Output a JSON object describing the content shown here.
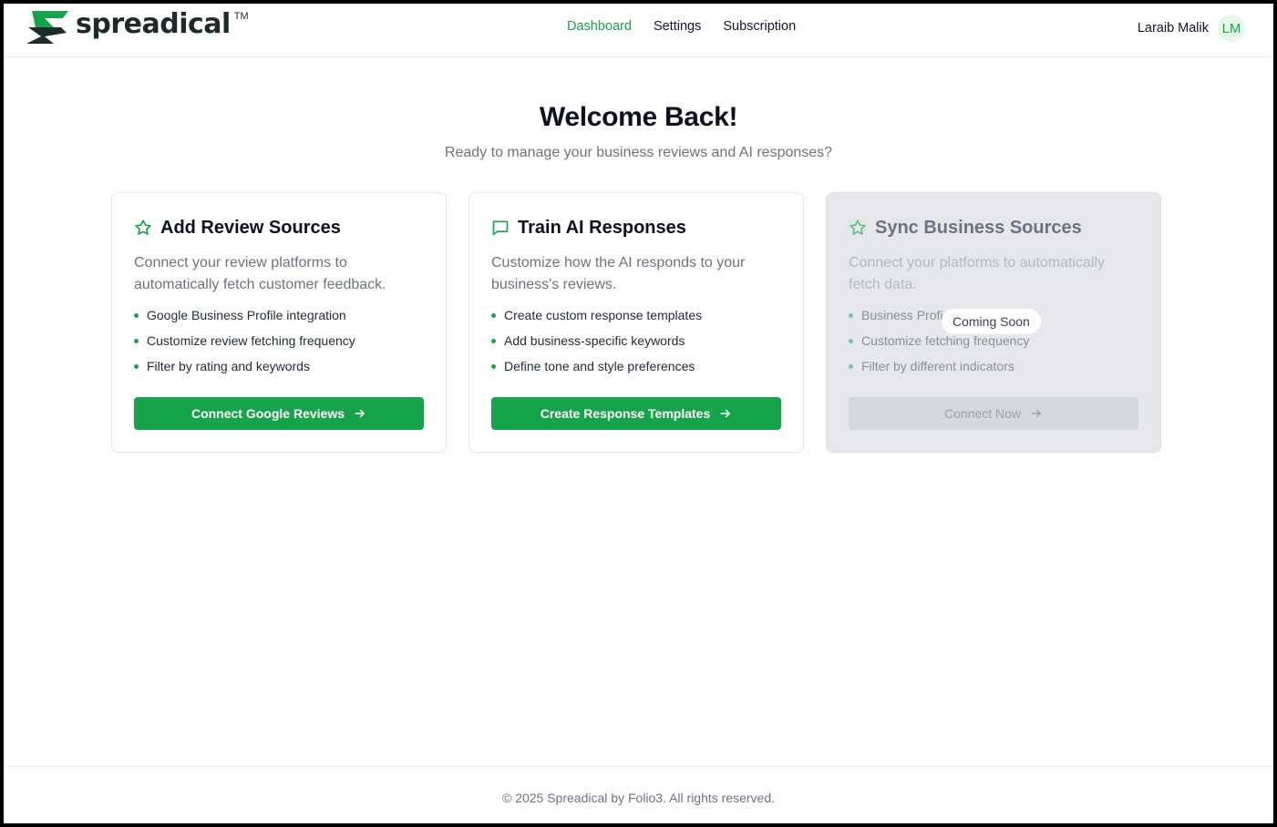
{
  "brand": {
    "name": "spreadical",
    "tm": "TM",
    "colors": {
      "primary": "#16a34a",
      "dark": "#1f2a2a"
    }
  },
  "nav": {
    "items": [
      {
        "label": "Dashboard",
        "active": true
      },
      {
        "label": "Settings",
        "active": false
      },
      {
        "label": "Subscription",
        "active": false
      }
    ]
  },
  "user": {
    "name": "Laraib Malik",
    "initials": "LM"
  },
  "hero": {
    "title": "Welcome Back!",
    "subtitle": "Ready to manage your business reviews and AI responses?"
  },
  "cards": [
    {
      "icon": "star-icon",
      "title": "Add Review Sources",
      "description": "Connect your review platforms to automatically fetch customer feedback.",
      "features": [
        "Google Business Profile integration",
        "Customize review fetching frequency",
        "Filter by rating and keywords"
      ],
      "button": "Connect Google Reviews"
    },
    {
      "icon": "message-square-icon",
      "title": "Train AI Responses",
      "description": "Customize how the AI responds to your business's reviews.",
      "features": [
        "Create custom response templates",
        "Add business-specific keywords",
        "Define tone and style preferences"
      ],
      "button": "Create Response Templates"
    },
    {
      "icon": "star-icon",
      "title": "Sync Business Sources",
      "description": "Connect your platforms to automatically fetch data.",
      "features": [
        "Business Profi",
        "Customize fetching frequency",
        "Filter by different indicators"
      ],
      "button": "Connect Now",
      "badge": "Coming Soon",
      "disabled": true
    }
  ],
  "footer": {
    "text": "© 2025 Spreadical by Folio3. All rights reserved."
  }
}
